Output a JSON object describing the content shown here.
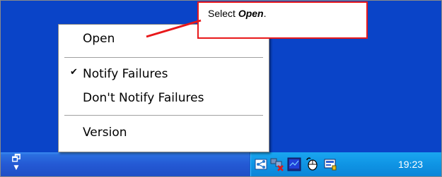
{
  "context_menu": {
    "items": [
      {
        "label": "Open",
        "checked": false
      },
      {
        "label": "Notify Failures",
        "checked": true
      },
      {
        "label": "Don't Notify Failures",
        "checked": false
      },
      {
        "label": "Version",
        "checked": false
      }
    ],
    "check_glyph": "✔"
  },
  "callout": {
    "prefix": "Select ",
    "emphasis": "Open",
    "suffix": ".",
    "border_color": "#e8181a"
  },
  "taskbar": {
    "quick_launch_icon": "window-stack-icon",
    "tray_icons": [
      "network-icon",
      "network-disconnected-icon",
      "monitor-icon",
      "mouse-icon",
      "status-app-icon"
    ],
    "clock": "19:23"
  },
  "colors": {
    "desktop": "#0a44c8",
    "taskbar": "#2459d4",
    "tray": "#0f94e4"
  }
}
